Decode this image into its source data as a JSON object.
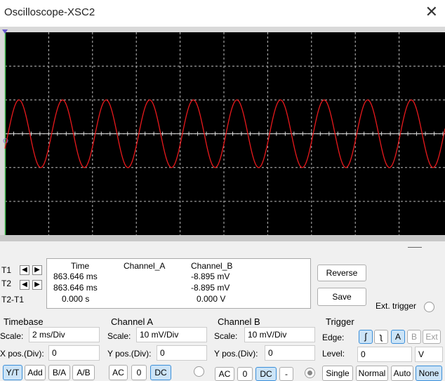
{
  "window": {
    "title": "Oscilloscope-XSC2"
  },
  "readout": {
    "rows": [
      {
        "label": "T1",
        "time": "863.646 ms",
        "channel_a": "",
        "channel_b": "-8.895 mV"
      },
      {
        "label": "T2",
        "time": "863.646 ms",
        "channel_a": "",
        "channel_b": "-8.895 mV"
      },
      {
        "label": "T2-T1",
        "time": "0.000 s",
        "channel_a": "",
        "channel_b": "0.000 V"
      }
    ],
    "headers": {
      "time": "Time",
      "channel_a": "Channel_A",
      "channel_b": "Channel_B"
    },
    "reverse_label": "Reverse",
    "save_label": "Save",
    "ext_trigger_label": "Ext. trigger",
    "left_arrow": "🡐",
    "right_arrow": "🡒"
  },
  "timebase": {
    "title": "Timebase",
    "scale_label": "Scale:",
    "scale_value": "2 ms/Div",
    "xpos_label": "X pos.(Div):",
    "xpos_value": "0",
    "modes": [
      "Y/T",
      "Add",
      "B/A",
      "A/B"
    ],
    "selected_mode": "Y/T"
  },
  "channel_a": {
    "title": "Channel A",
    "scale_label": "Scale:",
    "scale_value": "10 mV/Div",
    "ypos_label": "Y pos.(Div):",
    "ypos_value": "0",
    "coupling": [
      "AC",
      "0",
      "DC"
    ],
    "selected_coupling": "DC"
  },
  "channel_b": {
    "title": "Channel B",
    "scale_label": "Scale:",
    "scale_value": "10 mV/Div",
    "ypos_label": "Y pos.(Div):",
    "ypos_value": "0",
    "coupling": [
      "AC",
      "0",
      "DC",
      "-"
    ],
    "selected_coupling": "DC"
  },
  "trigger": {
    "title": "Trigger",
    "edge_label": "Edge:",
    "edge_rising": "⨍",
    "edge_falling": "⨍",
    "sources": [
      "A",
      "B",
      "Ext"
    ],
    "selected_source": "A",
    "level_label": "Level:",
    "level_value": "0",
    "level_unit": "V",
    "modes": [
      "Single",
      "Normal",
      "Auto",
      "None"
    ],
    "selected_mode": "None"
  },
  "trace": {
    "color": "#e8191c",
    "grid_color": "#bdbdbd",
    "cycles_visible": 10,
    "peak_divisions": 1.0
  }
}
